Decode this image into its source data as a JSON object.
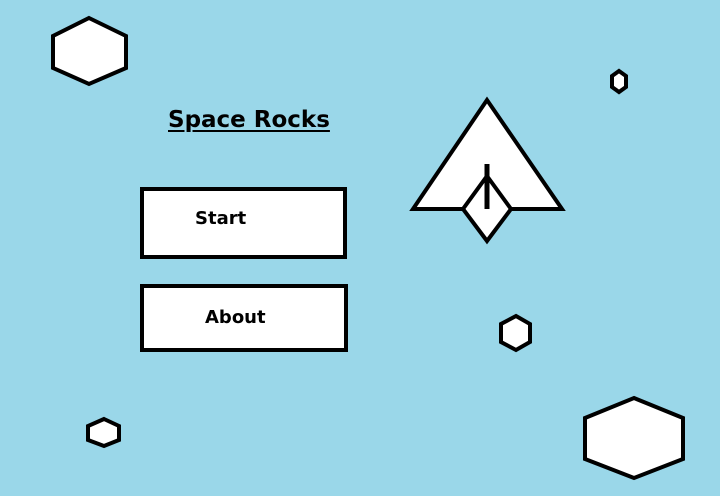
{
  "game": {
    "title": "Space Rocks"
  },
  "menu": {
    "start_label": "Start",
    "about_label": "About"
  },
  "colors": {
    "background": "#9ad7e9",
    "outline": "#000000",
    "fill": "#ffffff"
  }
}
